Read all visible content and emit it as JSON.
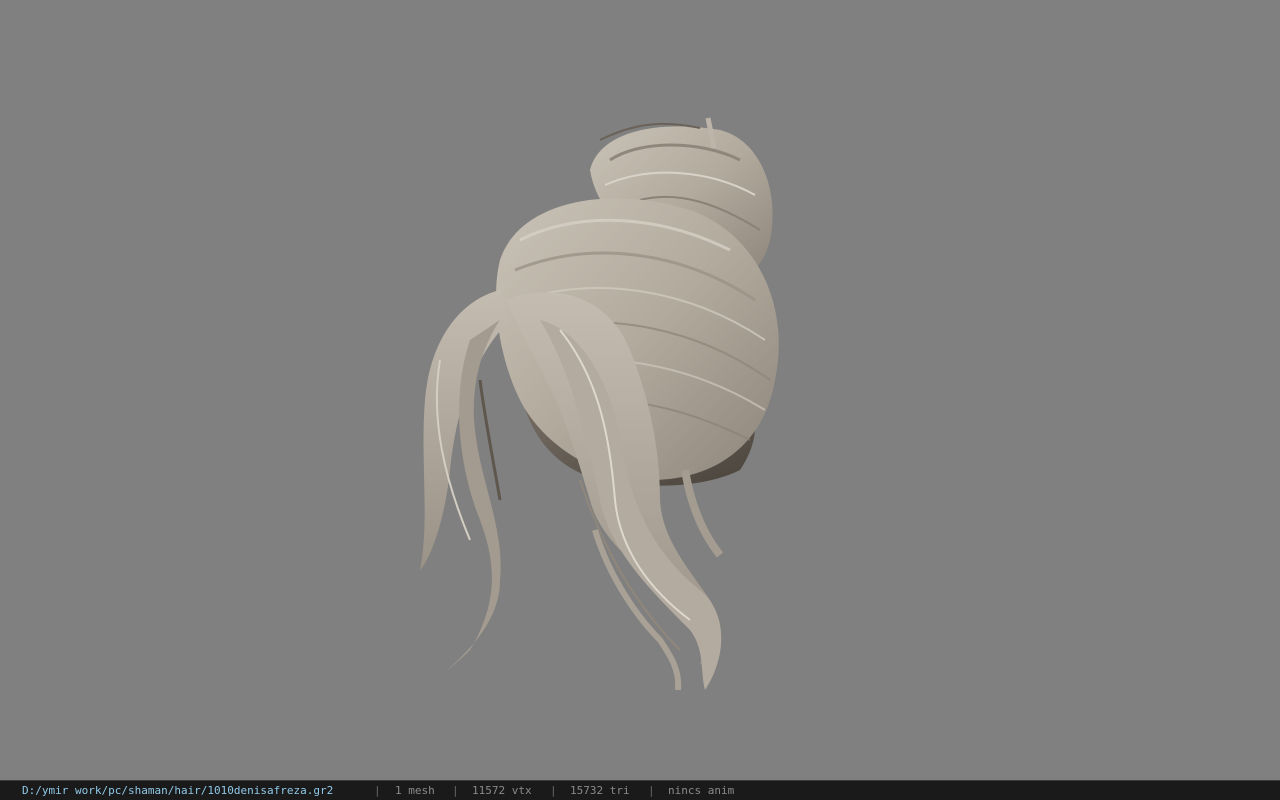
{
  "viewport": {
    "background": "#808080",
    "model": "hair-mesh",
    "hair_color": "#b9b1a5"
  },
  "status": {
    "file_path": "D:/ymir work/pc/shaman/hair/1010denisafreza.gr2",
    "separator": "|",
    "mesh_count": "1 mesh",
    "vertex_count": "11572 vtx",
    "triangle_count": "15732 tri",
    "anim_status": "nincs anim"
  }
}
